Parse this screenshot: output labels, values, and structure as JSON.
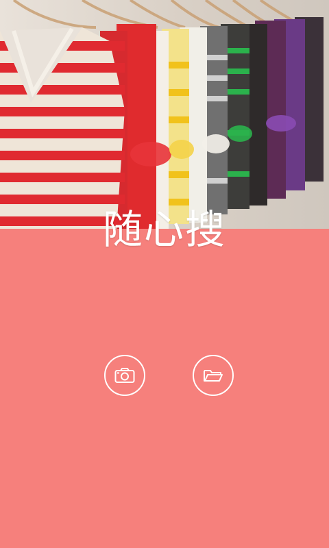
{
  "app": {
    "title": "随心搜"
  },
  "actions": [
    {
      "icon": "camera-icon"
    },
    {
      "icon": "folder-open-icon"
    }
  ],
  "colors": {
    "background": "#f6807c",
    "foreground": "#ffffff"
  }
}
